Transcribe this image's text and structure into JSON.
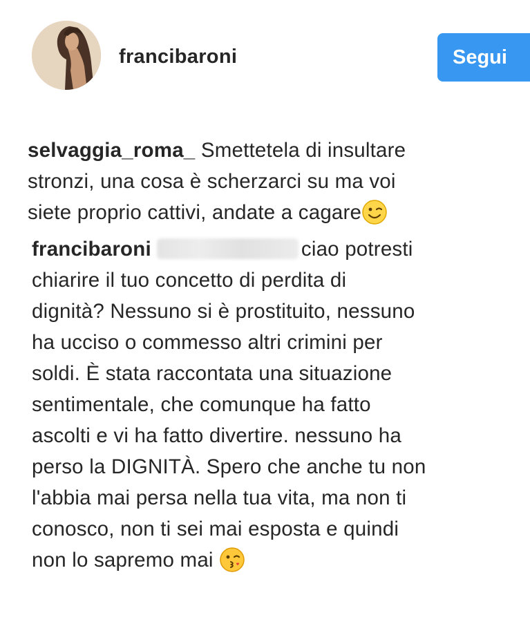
{
  "post": {
    "username": "francibaroni",
    "follow_label": "Segui"
  },
  "comments": [
    {
      "username": "selvaggia_roma_",
      "lines": [
        " Smettetela di insultare",
        "stronzi, una cosa è scherzarci su ma voi",
        "siete proprio cattivi, andate a cagare"
      ],
      "emoji": "wink-smiley-icon"
    },
    {
      "username": "francibaroni",
      "mention_redacted": true,
      "lines": [
        "ciao potresti",
        "chiarire il tuo concetto di perdita di",
        "dignità? Nessuno si è prostituito, nessuno",
        "ha ucciso o commesso altri crimini per",
        "soldi. È stata raccontata una situazione",
        "sentimentale, che comunque ha fatto",
        "ascolti e vi ha fatto divertire. nessuno ha",
        "perso la DIGNITÀ. Spero che anche tu non",
        "l'abbia mai persa nella tua vita, ma non ti",
        "conosco, non ti sei mai esposta e quindi",
        "non lo sapremo mai "
      ],
      "emoji": "kiss-wink-icon"
    }
  ],
  "colors": {
    "follow_button": "#3897f0",
    "text": "#262626"
  }
}
